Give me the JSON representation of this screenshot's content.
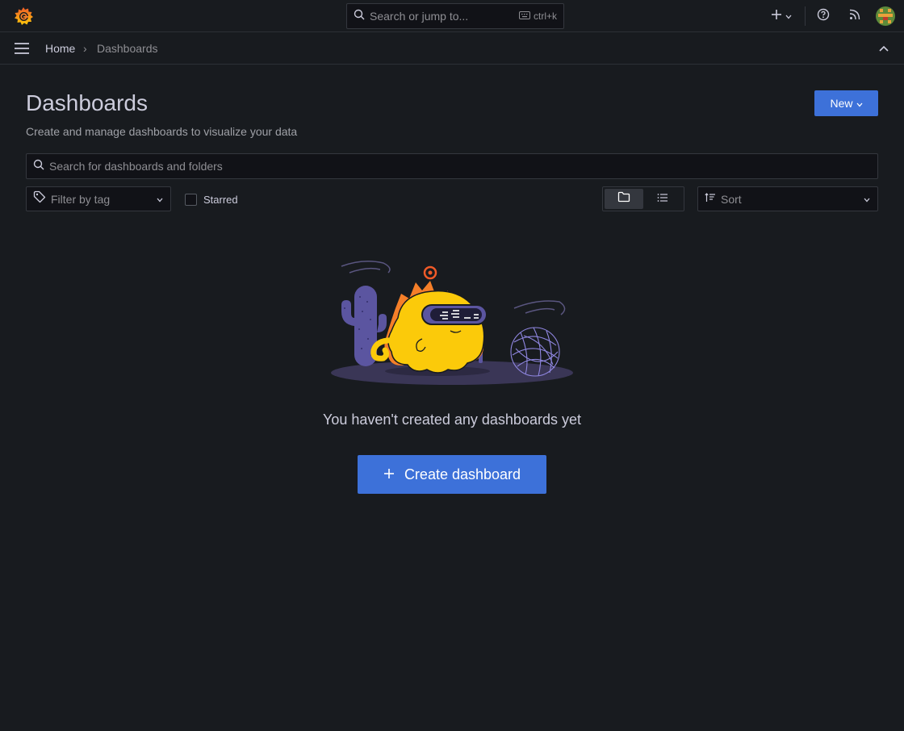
{
  "topbar": {
    "search_placeholder": "Search or jump to...",
    "shortcut": "ctrl+k"
  },
  "breadcrumb": {
    "home": "Home",
    "separator": "›",
    "current": "Dashboards"
  },
  "header": {
    "title": "Dashboards",
    "subtitle": "Create and manage dashboards to visualize your data",
    "new_button": "New"
  },
  "filters": {
    "search_placeholder": "Search for dashboards and folders",
    "tag_placeholder": "Filter by tag",
    "starred_label": "Starred",
    "sort_placeholder": "Sort"
  },
  "empty_state": {
    "message": "You haven't created any dashboards yet",
    "create_button": "Create dashboard"
  },
  "colors": {
    "background": "#181b1f",
    "primary": "#3d71d9",
    "logo_orange": "#f05a28",
    "logo_yellow": "#fbca0a"
  },
  "icons": {
    "logo": "grafana-logo",
    "search": "search-icon",
    "keyboard": "keyboard-icon",
    "add": "plus-icon",
    "help": "help-icon",
    "news": "rss-icon",
    "menu": "menu-icon",
    "collapse": "chevron-up-icon",
    "tag": "tag-icon",
    "folder_view": "folder-icon",
    "list_view": "list-icon",
    "sort": "sort-icon"
  }
}
